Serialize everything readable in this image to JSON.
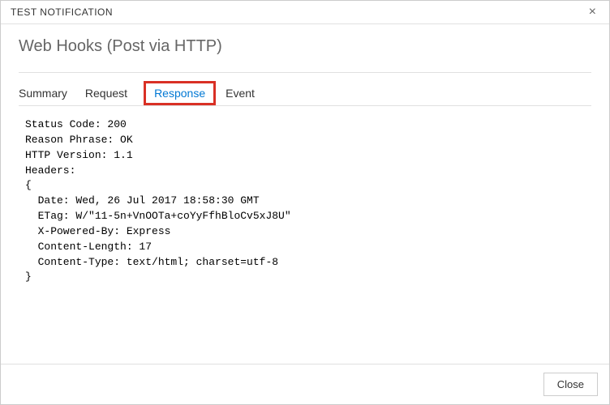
{
  "dialog": {
    "title": "TEST NOTIFICATION",
    "close_x": "×"
  },
  "header": {
    "title": "Web Hooks (Post via HTTP)"
  },
  "tabs": {
    "summary": "Summary",
    "request": "Request",
    "response": "Response",
    "event": "Event"
  },
  "response_body": "Status Code: 200\nReason Phrase: OK\nHTTP Version: 1.1\nHeaders:\n{\n  Date: Wed, 26 Jul 2017 18:58:30 GMT\n  ETag: W/\"11-5n+VnOOTa+coYyFfhBloCv5xJ8U\"\n  X-Powered-By: Express\n  Content-Length: 17\n  Content-Type: text/html; charset=utf-8\n}",
  "footer": {
    "close_label": "Close"
  }
}
